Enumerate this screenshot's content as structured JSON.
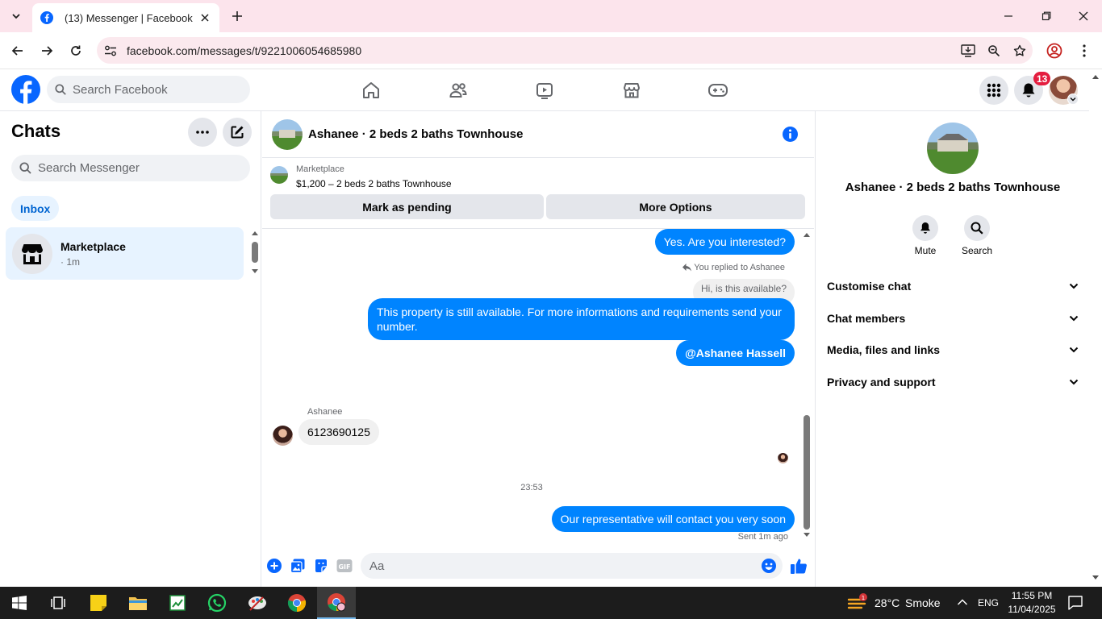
{
  "browser": {
    "tab_title": "(13) Messenger | Facebook",
    "url": "facebook.com/messages/t/9221006054685980"
  },
  "facebook": {
    "search_placeholder": "Search Facebook",
    "notification_count": "13",
    "brand_color": "#0866ff"
  },
  "left": {
    "title": "Chats",
    "search_placeholder": "Search Messenger",
    "inbox_label": "Inbox",
    "chats": [
      {
        "name": "Marketplace",
        "meta": "· 1m"
      }
    ]
  },
  "conversation": {
    "title": "Ashanee · 2 beds 2 baths Townhouse",
    "marketplace_label": "Marketplace",
    "listing": "$1,200 – 2 beds 2 baths Townhouse",
    "mark_pending": "Mark as pending",
    "more_options": "More Options",
    "messages": {
      "m1": "Yes. Are you interested?",
      "replied_note": "You replied to Ashanee",
      "quoted": "Hi, is this available?",
      "m2": "This property is still available. For more informations and requirements send your number.",
      "m3": "@Ashanee Hassell",
      "sender_name": "Ashanee",
      "incoming": "6123690125",
      "time": "23:53",
      "m4": "Our representative will contact you very soon",
      "sent_status": "Sent 1m ago"
    },
    "composer_placeholder": "Aa",
    "bubble_color": "#0084ff"
  },
  "right": {
    "title": "Ashanee · 2 beds 2 baths Townhouse",
    "mute_label": "Mute",
    "search_label": "Search",
    "sections": [
      "Customise chat",
      "Chat members",
      "Media, files and links",
      "Privacy and support"
    ]
  },
  "taskbar": {
    "weather_temp": "28°C",
    "weather_text": "Smoke",
    "lang": "ENG",
    "time": "11:55 PM",
    "date": "11/04/2025"
  }
}
